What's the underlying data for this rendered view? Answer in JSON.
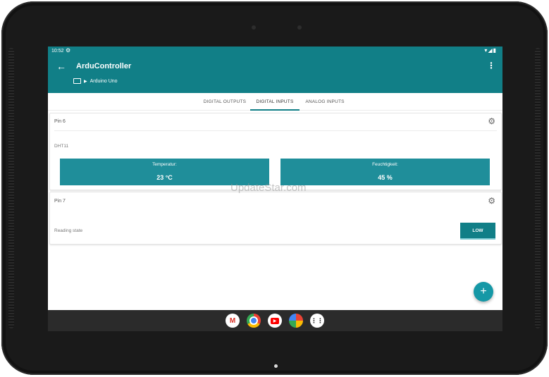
{
  "status": {
    "time": "10:52",
    "icons": "▾◢▮"
  },
  "appbar": {
    "title": "ArduController",
    "board": "Arduino Uno"
  },
  "tabs": [
    "DIGITAL OUTPUTS",
    "DIGITAL INPUTS",
    "ANALOG INPUTS"
  ],
  "active_tab": "DIGITAL INPUTS",
  "cards": [
    {
      "title": "Pin 6",
      "sensor": "DHT11",
      "values": [
        {
          "label": "Temperatur:",
          "value": "23 °C"
        },
        {
          "label": "Feuchtigkeit:",
          "value": "45 %"
        }
      ]
    },
    {
      "title": "Pin 7",
      "state_label": "Reading state",
      "state_button": "LOW"
    }
  ],
  "fab_label": "+",
  "watermark": "UpdateStar.com",
  "colors": {
    "primary": "#117f87",
    "accent": "#1f8e9a"
  },
  "taskbar": [
    "gmail-icon",
    "chrome-icon",
    "youtube-icon",
    "photos-icon",
    "app-drawer-icon"
  ]
}
